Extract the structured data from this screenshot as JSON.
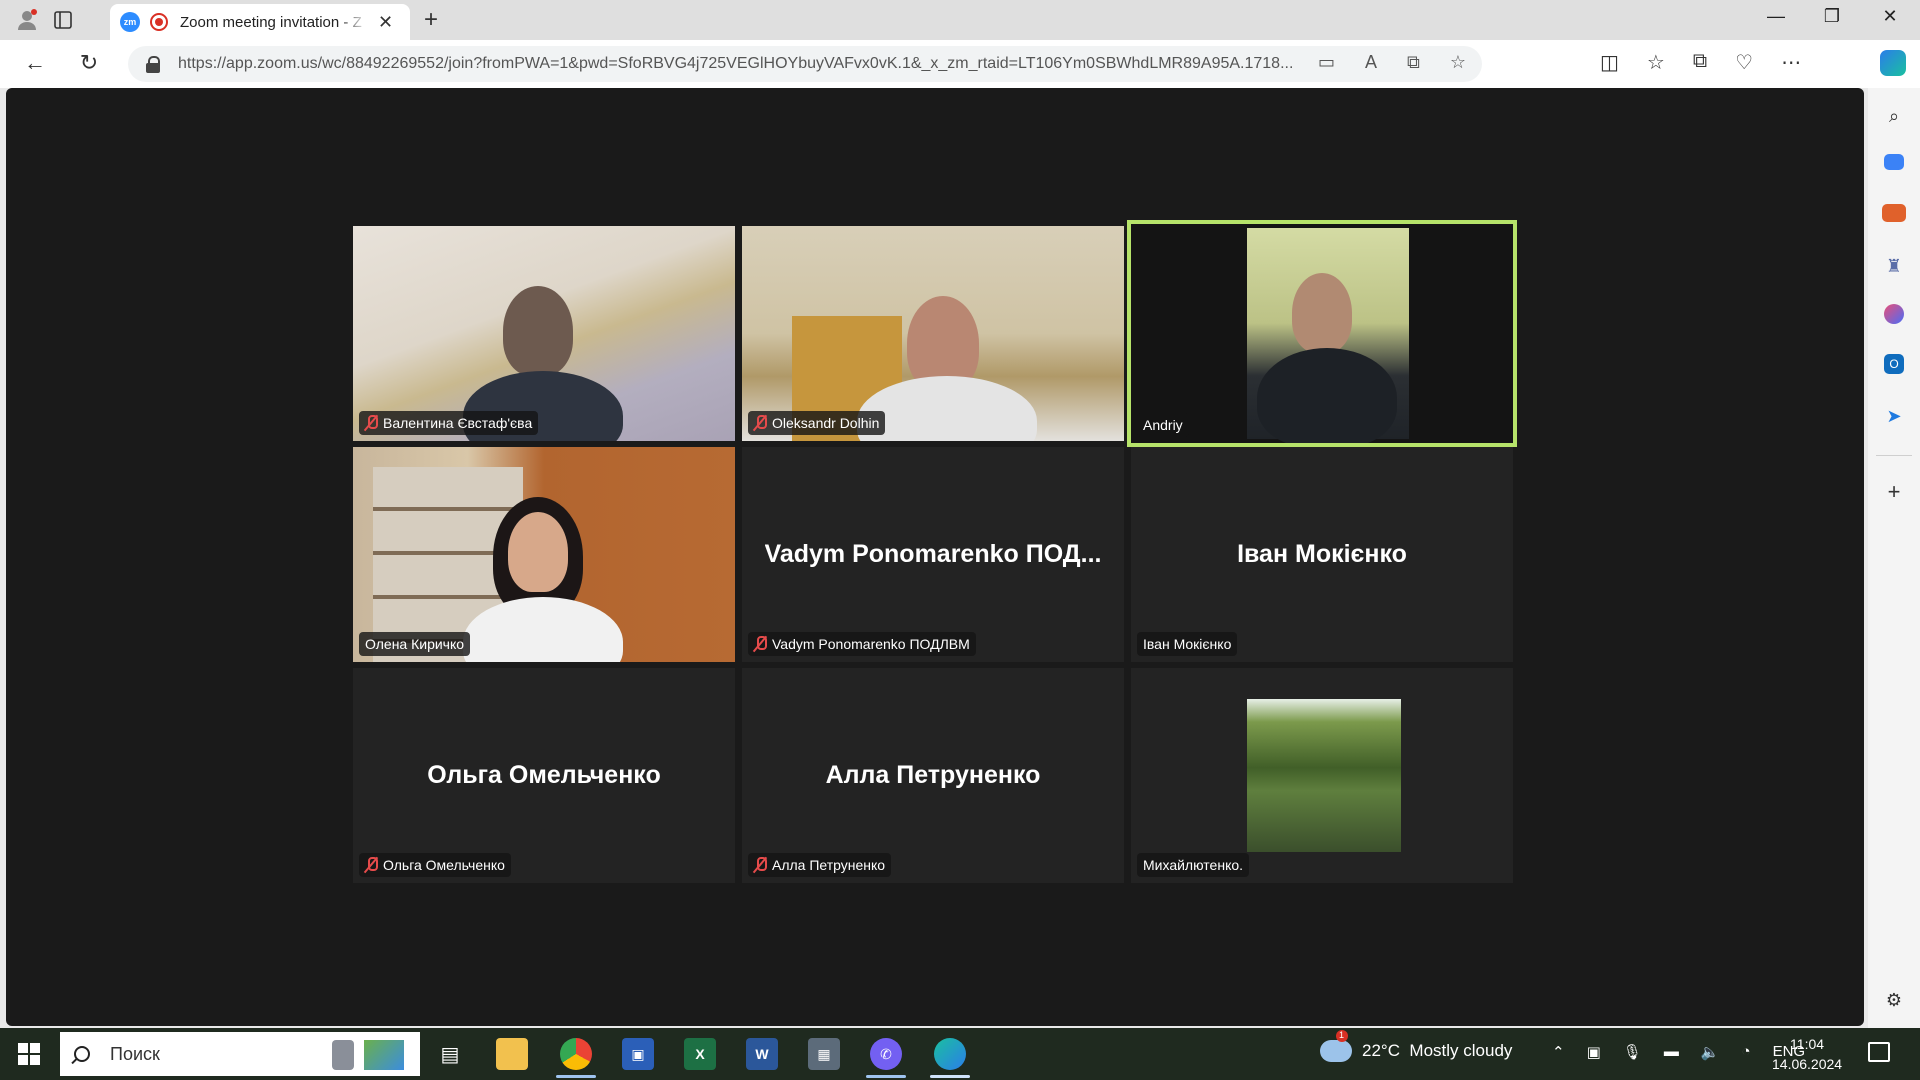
{
  "browser": {
    "tab_title": "Zoom meeting invitation - Z",
    "tab_favicon": "zm",
    "url": "https://app.zoom.us/wc/88492269552/join?fromPWA=1&pwd=SfoRBVG4j725VEGlHOYbuyVAFvx0vK.1&_x_zm_rtaid=LT106Ym0SBWhdLMR89A95A.1718...",
    "url_icons": [
      "video-icon",
      "read-aloud-icon",
      "app-available-icon",
      "favorite-star-icon"
    ],
    "toolbar_icons": [
      "split-screen-icon",
      "favorites-icon",
      "collections-icon",
      "browser-essentials-icon",
      "more-icon"
    ],
    "sidebar_icons": [
      "search-icon",
      "shopping-tag-icon",
      "tools-icon",
      "games-icon",
      "microsoft365-icon",
      "outlook-icon",
      "drop-icon",
      "add-icon",
      "settings-icon"
    ]
  },
  "meeting": {
    "accent_color": "#b6e36a",
    "tiles": [
      {
        "label": "Валентина Євстаф'єва",
        "muted": true,
        "video": true
      },
      {
        "label": "Oleksandr Dolhin",
        "muted": true,
        "video": true
      },
      {
        "label": "Andriy",
        "muted": false,
        "video": true,
        "active_speaker": true
      },
      {
        "label": "Олена Киричко",
        "muted": false,
        "video": true
      },
      {
        "label": "Vadym Ponomarenko ПОДЛВМ",
        "display_name": "Vadym Ponomarenko ПОД...",
        "muted": true,
        "video": false
      },
      {
        "label": "Іван Мокієнко",
        "display_name": "Іван Мокієнко",
        "muted": false,
        "video": false
      },
      {
        "label": "Ольга Омельченко",
        "display_name": "Ольга Омельченко",
        "muted": true,
        "video": false
      },
      {
        "label": "Алла Петруненко",
        "display_name": "Алла Петруненко",
        "muted": true,
        "video": false
      },
      {
        "label": "Михайлютенко.",
        "muted": false,
        "video": false,
        "avatar_image": true
      }
    ]
  },
  "taskbar": {
    "search_placeholder": "Поиск",
    "weather_badge": "1",
    "weather": "22°C  Mostly cloudy",
    "language": "ENG",
    "time": "11:04",
    "date": "14.06.2024"
  }
}
